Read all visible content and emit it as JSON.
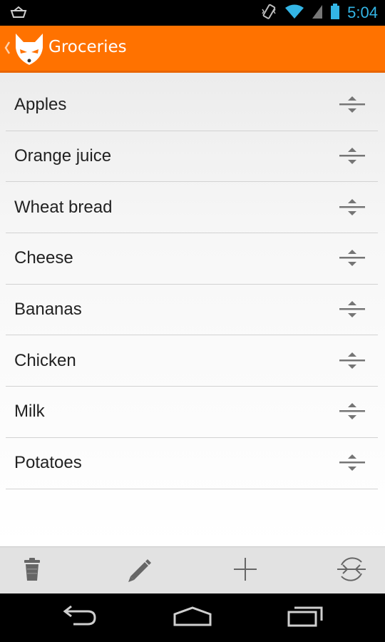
{
  "status_bar": {
    "time": "5:04"
  },
  "action_bar": {
    "title": "Groceries",
    "accent_color": "#ff7200"
  },
  "list": {
    "items": [
      {
        "label": "Apples"
      },
      {
        "label": "Orange juice"
      },
      {
        "label": "Wheat bread"
      },
      {
        "label": "Cheese"
      },
      {
        "label": "Bananas"
      },
      {
        "label": "Chicken"
      },
      {
        "label": "Milk"
      },
      {
        "label": "Potatoes"
      }
    ]
  },
  "bottom_actions": {
    "icons": [
      "trash-icon",
      "pencil-icon",
      "plus-icon",
      "sync-icon"
    ]
  },
  "nav": {
    "icons": [
      "back-icon",
      "home-icon",
      "recents-icon"
    ]
  }
}
